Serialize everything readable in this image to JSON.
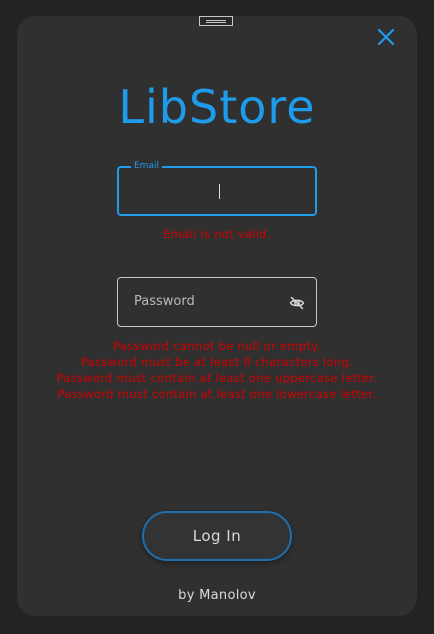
{
  "app": {
    "title": "LibStore",
    "accent_color": "#1e9bea",
    "error_color": "#d40000"
  },
  "form": {
    "email": {
      "label": "Email",
      "value": "",
      "error": "Email is not valid."
    },
    "password": {
      "placeholder": "Password",
      "value": "",
      "toggle_icon": "eye-off-icon",
      "errors": [
        "Password cannot be null or empty.",
        "Password must be at least 8 characters long.",
        "Password must contain at least one uppercase letter.",
        "Password must contain at least one lowercase letter."
      ]
    },
    "submit_label": "Log In"
  },
  "footer": {
    "credit": "by Manolov"
  },
  "window": {
    "close_icon": "close-icon",
    "drag_icon": "drag-handle-icon"
  }
}
